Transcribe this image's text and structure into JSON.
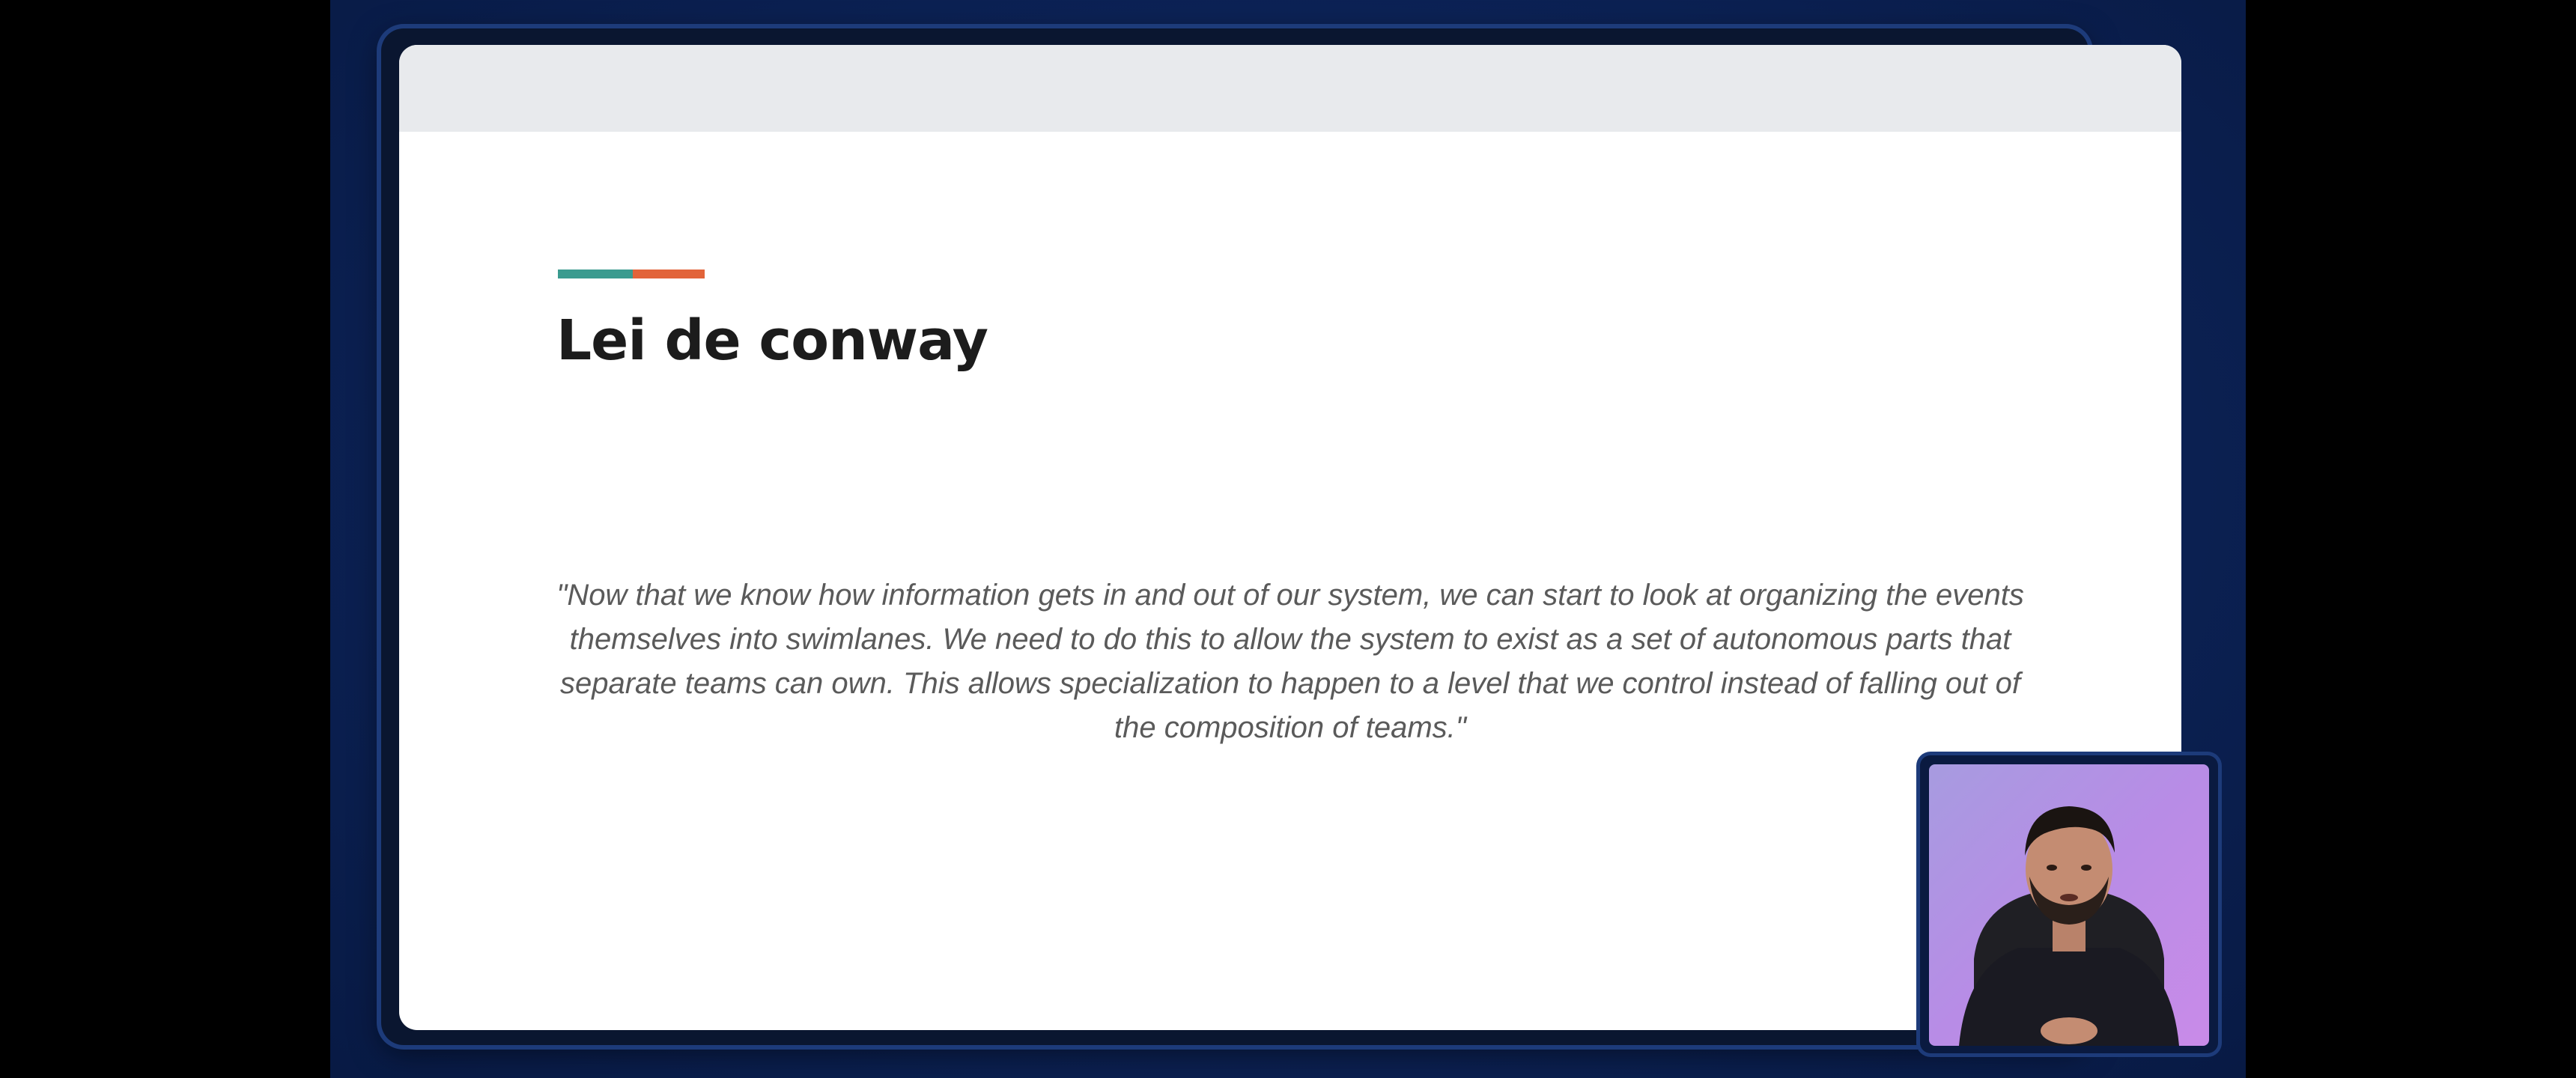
{
  "slide": {
    "title": "Lei de conway",
    "quote": "\"Now that we know how information gets in and out of our system, we can start to look at organizing the events themselves into swimlanes. We need to do this to allow the system to exist as a set of autonomous parts that separate teams can own. This allows specialization to happen to a level that we control instead of falling out of the composition of teams.\"",
    "accent_colors": [
      "#3a9b8f",
      "#e2643a"
    ]
  },
  "webcam": {
    "icon": "presenter-webcam"
  },
  "colors": {
    "background": "#0d245a",
    "slide_background": "#ffffff",
    "title": "#1c1c1c",
    "quote": "#5a5a5a"
  }
}
